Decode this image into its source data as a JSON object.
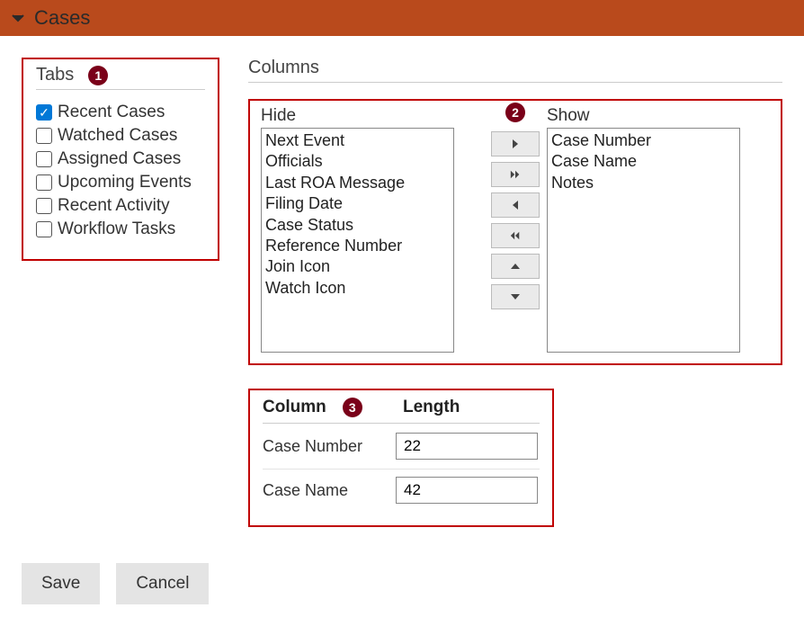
{
  "header": {
    "title": "Cases"
  },
  "tabs": {
    "title": "Tabs",
    "badge": "1",
    "items": [
      {
        "label": "Recent Cases",
        "checked": true
      },
      {
        "label": "Watched Cases",
        "checked": false
      },
      {
        "label": "Assigned Cases",
        "checked": false
      },
      {
        "label": "Upcoming Events",
        "checked": false
      },
      {
        "label": "Recent Activity",
        "checked": false
      },
      {
        "label": "Workflow Tasks",
        "checked": false
      }
    ]
  },
  "columns": {
    "title": "Columns",
    "badge": "2",
    "hide_label": "Hide",
    "show_label": "Show",
    "hide": [
      "Next Event",
      "Officials",
      "Last ROA Message",
      "Filing Date",
      "Case Status",
      "Reference Number",
      "Join Icon",
      "Watch Icon"
    ],
    "show": [
      "Case Number",
      "Case Name",
      "Notes"
    ]
  },
  "lengths": {
    "badge": "3",
    "column_header": "Column",
    "length_header": "Length",
    "rows": [
      {
        "name": "Case Number",
        "value": "22"
      },
      {
        "name": "Case Name",
        "value": "42"
      }
    ]
  },
  "buttons": {
    "save": "Save",
    "cancel": "Cancel"
  }
}
